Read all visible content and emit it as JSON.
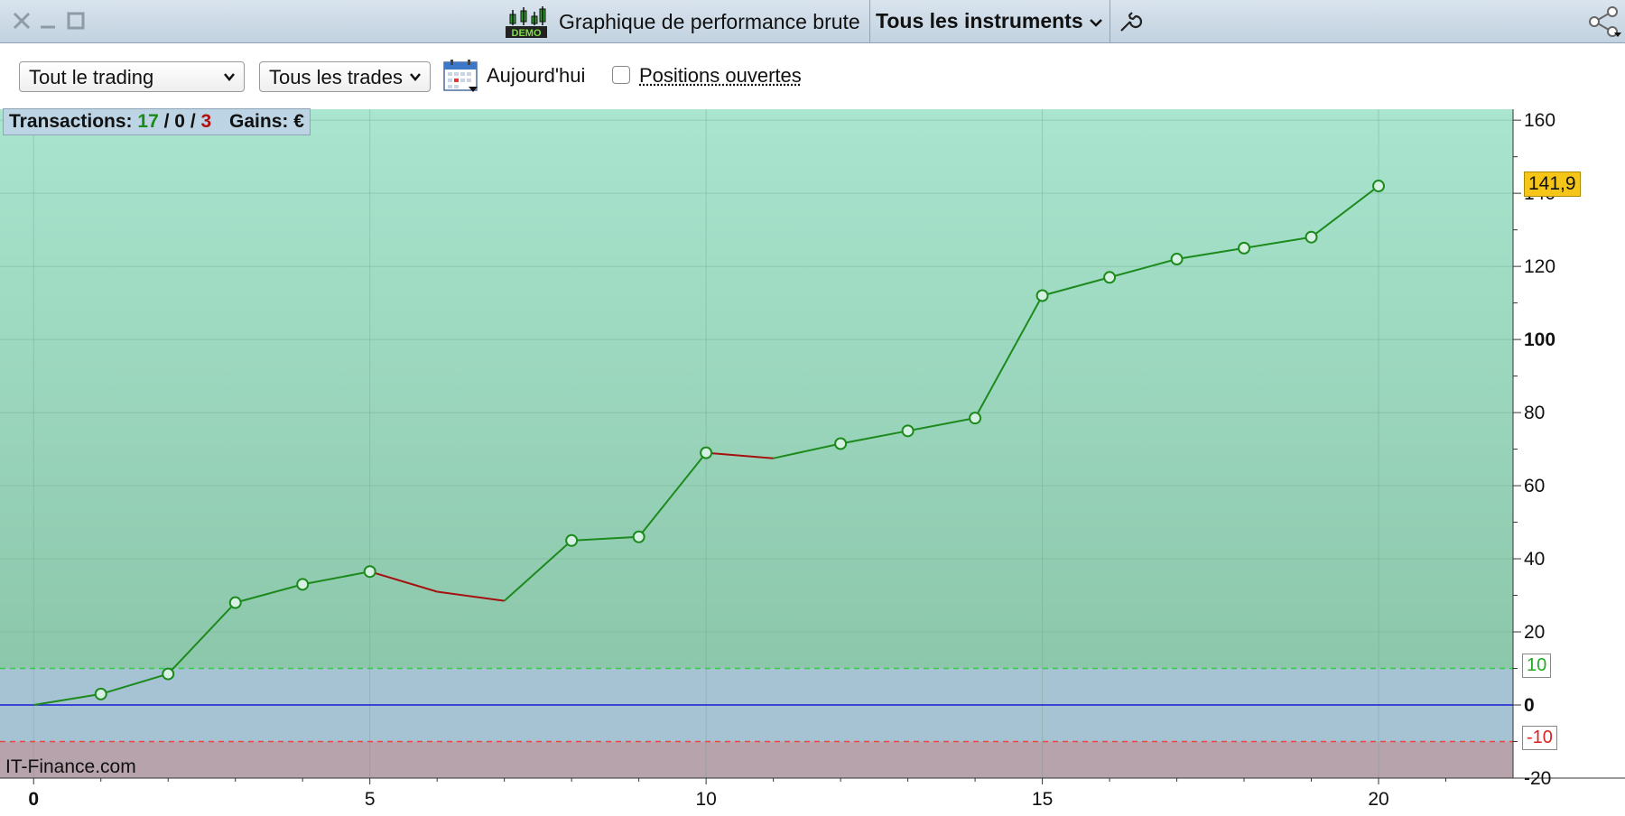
{
  "window": {
    "title": "Graphique de performance brute",
    "instrument_selector": "Tous les instruments",
    "logo_text": "DEMO"
  },
  "toolbar": {
    "scope_select": "Tout le trading",
    "trades_select": "Tous les trades",
    "date_label": "Aujourd'hui",
    "open_positions_label": "Positions ouvertes",
    "open_positions_checked": false
  },
  "stats": {
    "transactions_label": "Transactions:",
    "winning": "17",
    "neutral": "0",
    "losing": "3",
    "sep": "/",
    "gains_label": "Gains: €"
  },
  "watermark": "IT-Finance.com",
  "markers": {
    "last_value": "141,9",
    "upper_threshold": "10",
    "lower_threshold": "-10"
  },
  "colors": {
    "profit_zone": "#a6e3cb",
    "neutral_zone": "#a5c3d2",
    "loss_zone": "#b6a3ab",
    "gain_line": "#1c8a1c",
    "loss_line": "#a51010",
    "zero_line": "#1a1ad6",
    "last_value_tag": "#f5c518"
  },
  "chart_data": {
    "type": "line",
    "x": [
      0,
      1,
      2,
      3,
      4,
      5,
      6,
      7,
      8,
      9,
      10,
      11,
      12,
      13,
      14,
      15,
      16,
      17,
      18,
      19,
      20
    ],
    "values": [
      0,
      3,
      8.5,
      28,
      33,
      36.5,
      31,
      28.5,
      45,
      46,
      69,
      67.5,
      71.5,
      75,
      78.5,
      112,
      117,
      122,
      125,
      128,
      142
    ],
    "segment_is_loss": [
      false,
      false,
      false,
      false,
      false,
      true,
      true,
      false,
      false,
      false,
      true,
      false,
      false,
      false,
      false,
      false,
      false,
      false,
      false,
      false
    ],
    "xlim": [
      -0.5,
      22
    ],
    "ylim": [
      -20,
      163
    ],
    "x_ticks": [
      "0",
      "5",
      "10",
      "15",
      "20"
    ],
    "x_tick_values": [
      0,
      5,
      10,
      15,
      20
    ],
    "y_ticks": [
      "160",
      "140",
      "120",
      "100",
      "80",
      "60",
      "40",
      "20",
      "0",
      "-20"
    ],
    "y_tick_values": [
      160,
      140,
      120,
      100,
      80,
      60,
      40,
      20,
      0,
      -20
    ],
    "zone_upper": 10,
    "zone_lower": -10,
    "grid": true
  }
}
